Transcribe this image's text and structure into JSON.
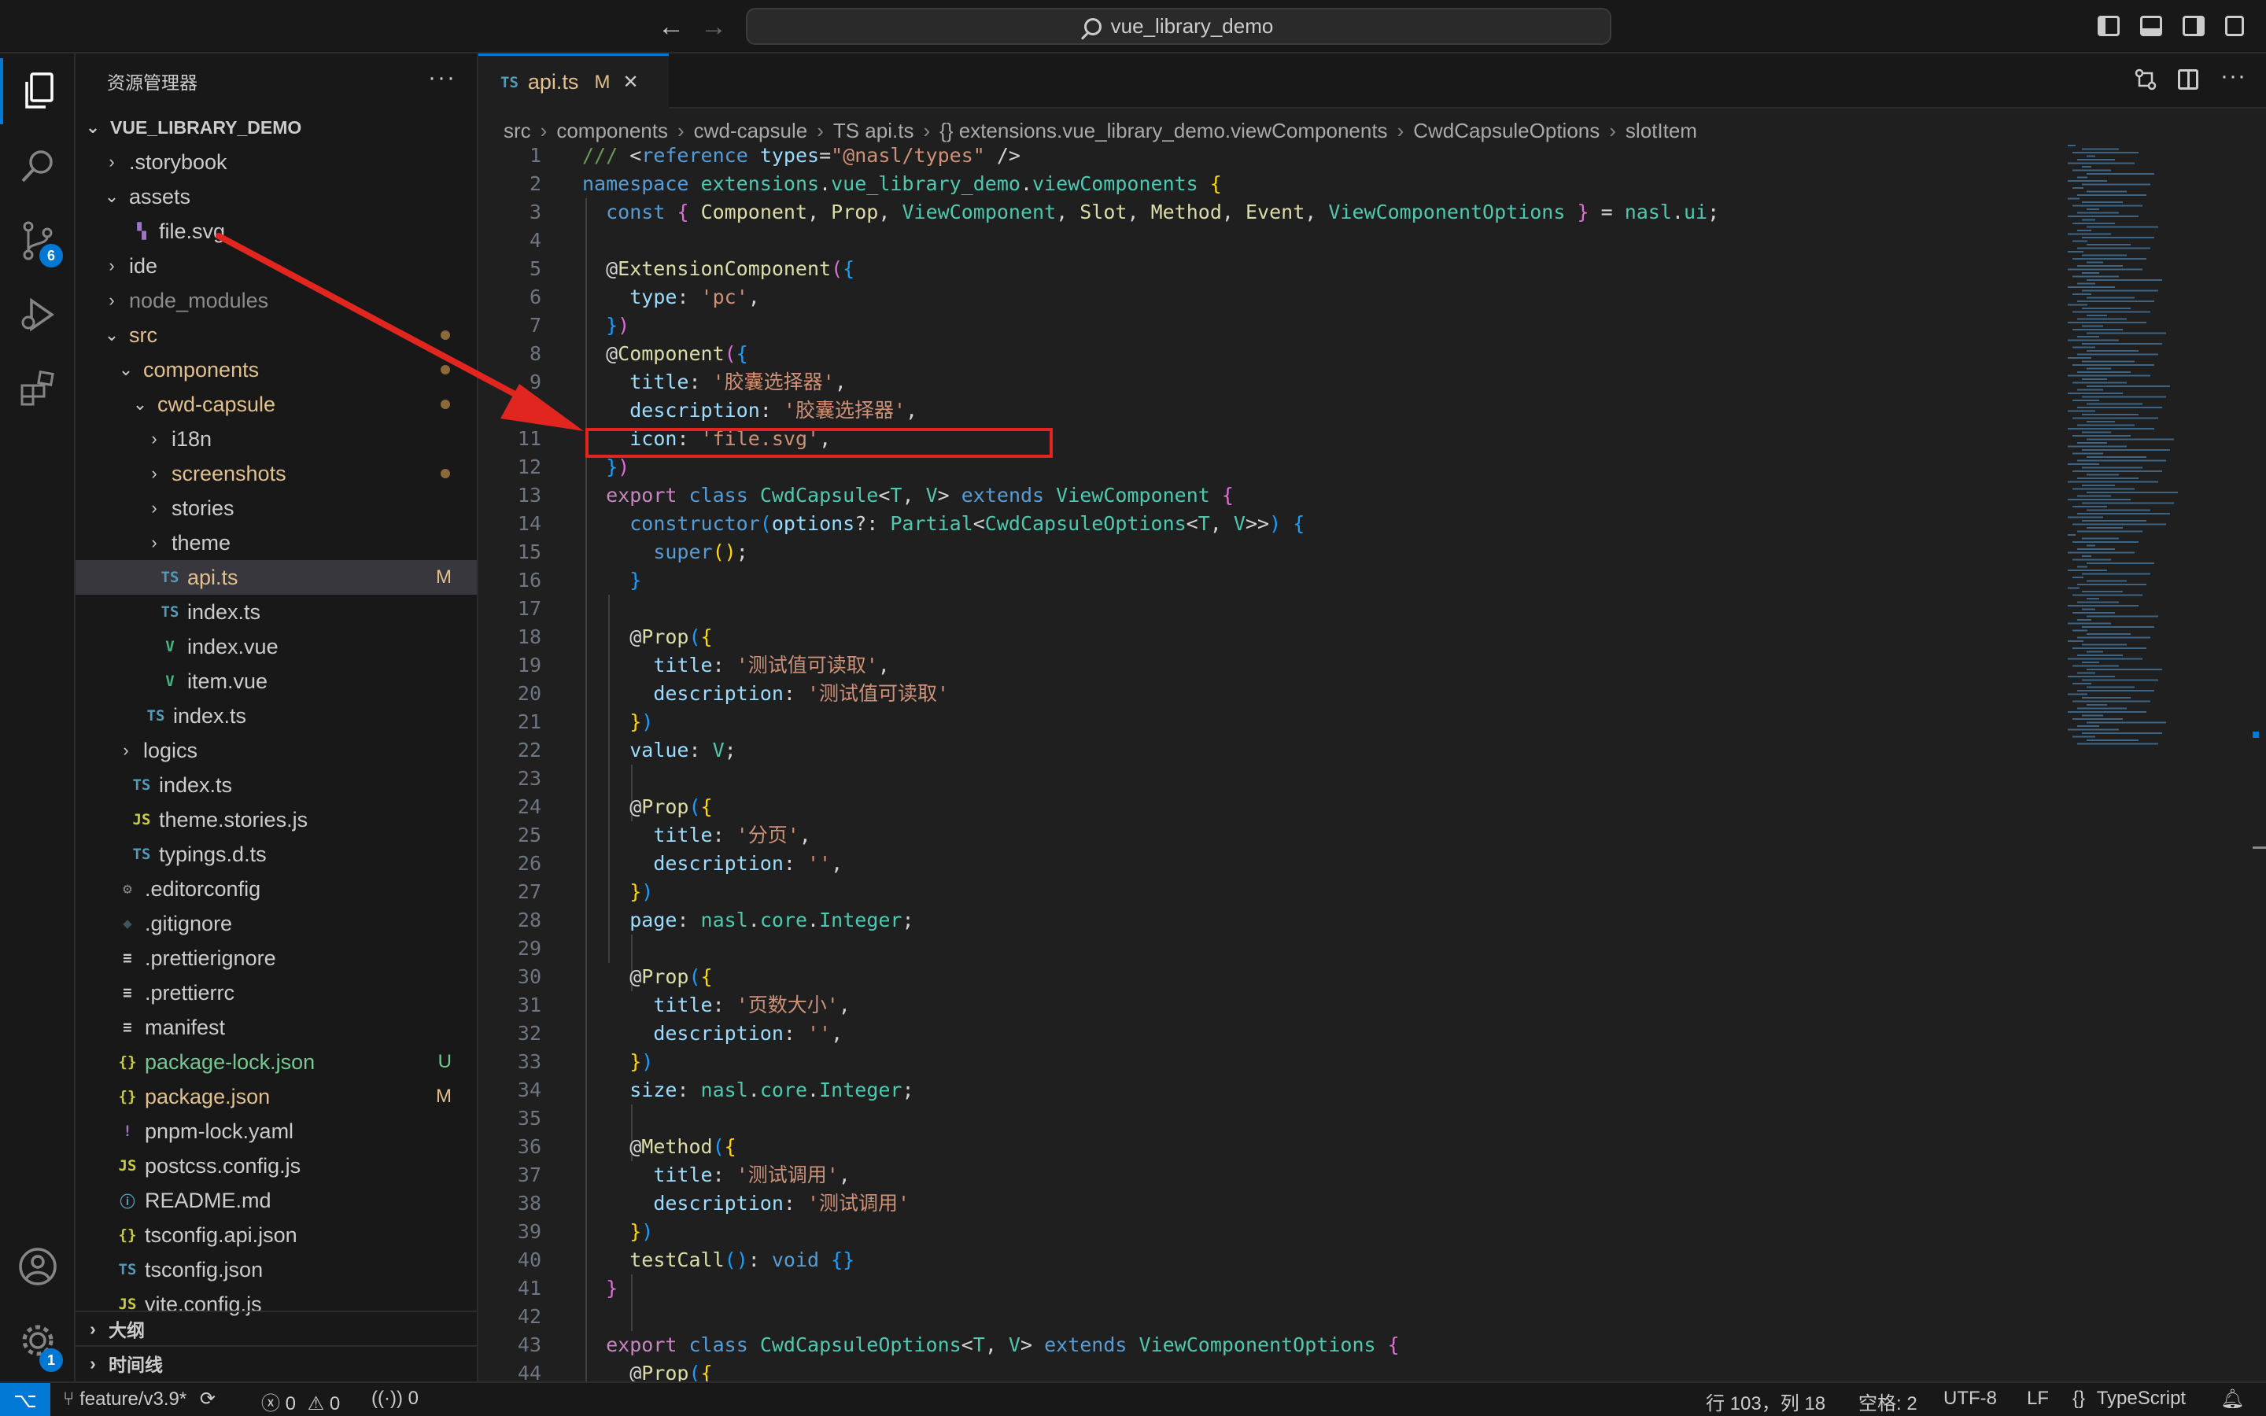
{
  "titlebar": {
    "search_text": "vue_library_demo",
    "back_icon": "arrow-left-icon",
    "forward_icon": "arrow-right-icon"
  },
  "activity_bar": {
    "source_control_badge": "6",
    "settings_badge": "1"
  },
  "sidebar": {
    "title": "资源管理器",
    "more": "···",
    "root_folder": "VUE_LIBRARY_DEMO",
    "items": [
      {
        "label": "storybook",
        "prefix": ".",
        "kind": "folder",
        "open": false,
        "depth": 1,
        "color": "#cccccc"
      },
      {
        "label": "assets",
        "prefix": "",
        "kind": "folder",
        "open": true,
        "depth": 1,
        "color": "#cccccc"
      },
      {
        "label": "file.svg",
        "prefix": "",
        "kind": "svg",
        "depth": 2,
        "color": "#cccccc"
      },
      {
        "label": "ide",
        "prefix": "",
        "kind": "folder",
        "open": false,
        "depth": 1,
        "color": "#cccccc"
      },
      {
        "label": "node_modules",
        "prefix": "",
        "kind": "folder",
        "open": false,
        "depth": 1,
        "color": "#8b8b8b"
      },
      {
        "label": "src",
        "prefix": "",
        "kind": "folder",
        "open": true,
        "depth": 1,
        "color": "#e2c08d",
        "dot": true
      },
      {
        "label": "components",
        "prefix": "",
        "kind": "folder",
        "open": true,
        "depth": 2,
        "color": "#e2c08d",
        "dot": true
      },
      {
        "label": "cwd-capsule",
        "prefix": "",
        "kind": "folder",
        "open": true,
        "depth": 3,
        "color": "#e2c08d",
        "dot": true
      },
      {
        "label": "i18n",
        "prefix": "",
        "kind": "folder",
        "open": false,
        "depth": 4,
        "color": "#cccccc"
      },
      {
        "label": "screenshots",
        "prefix": "",
        "kind": "folder",
        "open": false,
        "depth": 4,
        "color": "#e2c08d",
        "dot": true
      },
      {
        "label": "stories",
        "prefix": "",
        "kind": "folder",
        "open": false,
        "depth": 4,
        "color": "#cccccc"
      },
      {
        "label": "theme",
        "prefix": "",
        "kind": "folder",
        "open": false,
        "depth": 4,
        "color": "#cccccc"
      },
      {
        "label": "api.ts",
        "prefix": "",
        "kind": "ts",
        "depth": 4,
        "color": "#e2c08d",
        "status": "M",
        "selected": true
      },
      {
        "label": "index.ts",
        "prefix": "",
        "kind": "ts",
        "depth": 4,
        "color": "#cccccc"
      },
      {
        "label": "index.vue",
        "prefix": "",
        "kind": "vue",
        "depth": 4,
        "color": "#cccccc"
      },
      {
        "label": "item.vue",
        "prefix": "",
        "kind": "vue",
        "depth": 4,
        "color": "#cccccc"
      },
      {
        "label": "index.ts",
        "prefix": "",
        "kind": "ts",
        "depth": 3,
        "color": "#cccccc"
      },
      {
        "label": "logics",
        "prefix": "",
        "kind": "folder",
        "open": false,
        "depth": 2,
        "color": "#cccccc"
      },
      {
        "label": "index.ts",
        "prefix": "",
        "kind": "ts",
        "depth": 2,
        "color": "#cccccc"
      },
      {
        "label": "theme.stories.js",
        "prefix": "",
        "kind": "js",
        "depth": 2,
        "color": "#cccccc"
      },
      {
        "label": "typings.d.ts",
        "prefix": "",
        "kind": "ts",
        "depth": 2,
        "color": "#cccccc"
      },
      {
        "label": "editorconfig",
        "prefix": ".",
        "kind": "gear",
        "depth": 1,
        "color": "#cccccc"
      },
      {
        "label": "gitignore",
        "prefix": ".",
        "kind": "git",
        "depth": 1,
        "color": "#cccccc"
      },
      {
        "label": "prettierignore",
        "prefix": ".",
        "kind": "lines",
        "depth": 1,
        "color": "#cccccc"
      },
      {
        "label": "prettierrc",
        "prefix": ".",
        "kind": "lines",
        "depth": 1,
        "color": "#cccccc"
      },
      {
        "label": "manifest",
        "prefix": "",
        "kind": "lines",
        "depth": 1,
        "color": "#cccccc"
      },
      {
        "label": "package-lock.json",
        "prefix": "",
        "kind": "json",
        "depth": 1,
        "color": "#73c991",
        "status": "U"
      },
      {
        "label": "package.json",
        "prefix": "",
        "kind": "json",
        "depth": 1,
        "color": "#e2c08d",
        "status": "M"
      },
      {
        "label": "pnpm-lock.yaml",
        "prefix": "",
        "kind": "yaml",
        "depth": 1,
        "color": "#cccccc"
      },
      {
        "label": "postcss.config.js",
        "prefix": "",
        "kind": "js",
        "depth": 1,
        "color": "#cccccc"
      },
      {
        "label": "README.md",
        "prefix": "",
        "kind": "info",
        "depth": 1,
        "color": "#cccccc"
      },
      {
        "label": "tsconfig.api.json",
        "prefix": "",
        "kind": "json",
        "depth": 1,
        "color": "#cccccc"
      },
      {
        "label": "tsconfig.json",
        "prefix": "",
        "kind": "tsconfig",
        "depth": 1,
        "color": "#cccccc"
      },
      {
        "label": "vite.config.js",
        "prefix": "",
        "kind": "js",
        "depth": 1,
        "color": "#cccccc"
      }
    ],
    "outline_label": "大纲",
    "timeline_label": "时间线"
  },
  "editor": {
    "tab": {
      "icon": "TS",
      "label": "api.ts",
      "status": "M",
      "close": "✕"
    },
    "breadcrumb": [
      "src",
      "components",
      "cwd-capsule",
      "TS api.ts",
      "{} extensions.vue_library_demo.viewComponents",
      "CwdCapsuleOptions",
      "slotItem"
    ],
    "lines": [
      [
        [
          "cm",
          "/// "
        ],
        [
          "tx",
          "<"
        ],
        [
          "kw",
          "reference"
        ],
        [
          "tx",
          " "
        ],
        [
          "vr",
          "types"
        ],
        [
          "tx",
          "="
        ],
        [
          "st",
          "\"@nasl/types\""
        ],
        [
          "tx",
          " />"
        ]
      ],
      [
        [
          "kw",
          "namespace"
        ],
        [
          "tx",
          " "
        ],
        [
          "ty",
          "extensions"
        ],
        [
          "tx",
          "."
        ],
        [
          "ty",
          "vue_library_demo"
        ],
        [
          "tx",
          "."
        ],
        [
          "ty",
          "viewComponents"
        ],
        [
          "tx",
          " "
        ],
        [
          "br",
          "{"
        ]
      ],
      [
        [
          "tx",
          "  "
        ],
        [
          "kw",
          "const"
        ],
        [
          "tx",
          " "
        ],
        [
          "br2",
          "{"
        ],
        [
          "tx",
          " "
        ],
        [
          "fn",
          "Component"
        ],
        [
          "tx",
          ", "
        ],
        [
          "fn",
          "Prop"
        ],
        [
          "tx",
          ", "
        ],
        [
          "ty",
          "ViewComponent"
        ],
        [
          "tx",
          ", "
        ],
        [
          "fn",
          "Slot"
        ],
        [
          "tx",
          ", "
        ],
        [
          "fn",
          "Method"
        ],
        [
          "tx",
          ", "
        ],
        [
          "fn",
          "Event"
        ],
        [
          "tx",
          ", "
        ],
        [
          "ty",
          "ViewComponentOptions"
        ],
        [
          "tx",
          " "
        ],
        [
          "br2",
          "}"
        ],
        [
          "tx",
          " = "
        ],
        [
          "ty",
          "nasl"
        ],
        [
          "tx",
          "."
        ],
        [
          "ty",
          "ui"
        ],
        [
          "tx",
          ";"
        ]
      ],
      [],
      [
        [
          "tx",
          "  @"
        ],
        [
          "fn",
          "ExtensionComponent"
        ],
        [
          "br2",
          "("
        ],
        [
          "br3",
          "{"
        ]
      ],
      [
        [
          "tx",
          "    "
        ],
        [
          "vr",
          "type"
        ],
        [
          "tx",
          ": "
        ],
        [
          "st",
          "'pc'"
        ],
        [
          "tx",
          ","
        ]
      ],
      [
        [
          "tx",
          "  "
        ],
        [
          "br3",
          "}"
        ],
        [
          "br2",
          ")"
        ]
      ],
      [
        [
          "tx",
          "  @"
        ],
        [
          "fn",
          "Component"
        ],
        [
          "br2",
          "("
        ],
        [
          "br3",
          "{"
        ]
      ],
      [
        [
          "tx",
          "    "
        ],
        [
          "vr",
          "title"
        ],
        [
          "tx",
          ": "
        ],
        [
          "st",
          "'胶囊选择器'"
        ],
        [
          "tx",
          ","
        ]
      ],
      [
        [
          "tx",
          "    "
        ],
        [
          "vr",
          "description"
        ],
        [
          "tx",
          ": "
        ],
        [
          "st",
          "'胶囊选择器'"
        ],
        [
          "tx",
          ","
        ]
      ],
      [
        [
          "tx",
          "    "
        ],
        [
          "vr",
          "icon"
        ],
        [
          "tx",
          ": "
        ],
        [
          "st",
          "'file.svg'"
        ],
        [
          "tx",
          ","
        ]
      ],
      [
        [
          "tx",
          "  "
        ],
        [
          "br3",
          "}"
        ],
        [
          "br2",
          ")"
        ]
      ],
      [
        [
          "tx",
          "  "
        ],
        [
          "kc",
          "export"
        ],
        [
          "tx",
          " "
        ],
        [
          "kw",
          "class"
        ],
        [
          "tx",
          " "
        ],
        [
          "ty",
          "CwdCapsule"
        ],
        [
          "tx",
          "<"
        ],
        [
          "ty",
          "T"
        ],
        [
          "tx",
          ", "
        ],
        [
          "ty",
          "V"
        ],
        [
          "tx",
          "> "
        ],
        [
          "kw",
          "extends"
        ],
        [
          "tx",
          " "
        ],
        [
          "ty",
          "ViewComponent"
        ],
        [
          "tx",
          " "
        ],
        [
          "br2",
          "{"
        ]
      ],
      [
        [
          "tx",
          "    "
        ],
        [
          "kw",
          "constructor"
        ],
        [
          "br3",
          "("
        ],
        [
          "vr",
          "options"
        ],
        [
          "tx",
          "?: "
        ],
        [
          "ty",
          "Partial"
        ],
        [
          "tx",
          "<"
        ],
        [
          "ty",
          "CwdCapsuleOptions"
        ],
        [
          "tx",
          "<"
        ],
        [
          "ty",
          "T"
        ],
        [
          "tx",
          ", "
        ],
        [
          "ty",
          "V"
        ],
        [
          "tx",
          ">>"
        ],
        [
          "br3",
          ")"
        ],
        [
          "tx",
          " "
        ],
        [
          "br3",
          "{"
        ]
      ],
      [
        [
          "tx",
          "      "
        ],
        [
          "kw",
          "super"
        ],
        [
          "br",
          "()"
        ],
        [
          "tx",
          ";"
        ]
      ],
      [
        [
          "tx",
          "    "
        ],
        [
          "br3",
          "}"
        ]
      ],
      [],
      [
        [
          "tx",
          "    @"
        ],
        [
          "fn",
          "Prop"
        ],
        [
          "br3",
          "("
        ],
        [
          "br",
          "{"
        ]
      ],
      [
        [
          "tx",
          "      "
        ],
        [
          "vr",
          "title"
        ],
        [
          "tx",
          ": "
        ],
        [
          "st",
          "'测试值可读取'"
        ],
        [
          "tx",
          ","
        ]
      ],
      [
        [
          "tx",
          "      "
        ],
        [
          "vr",
          "description"
        ],
        [
          "tx",
          ": "
        ],
        [
          "st",
          "'测试值可读取'"
        ]
      ],
      [
        [
          "tx",
          "    "
        ],
        [
          "br",
          "}"
        ],
        [
          "br3",
          ")"
        ]
      ],
      [
        [
          "tx",
          "    "
        ],
        [
          "vr",
          "value"
        ],
        [
          "tx",
          ": "
        ],
        [
          "ty",
          "V"
        ],
        [
          "tx",
          ";"
        ]
      ],
      [],
      [
        [
          "tx",
          "    @"
        ],
        [
          "fn",
          "Prop"
        ],
        [
          "br3",
          "("
        ],
        [
          "br",
          "{"
        ]
      ],
      [
        [
          "tx",
          "      "
        ],
        [
          "vr",
          "title"
        ],
        [
          "tx",
          ": "
        ],
        [
          "st",
          "'分页'"
        ],
        [
          "tx",
          ","
        ]
      ],
      [
        [
          "tx",
          "      "
        ],
        [
          "vr",
          "description"
        ],
        [
          "tx",
          ": "
        ],
        [
          "st",
          "''"
        ],
        [
          "tx",
          ","
        ]
      ],
      [
        [
          "tx",
          "    "
        ],
        [
          "br",
          "}"
        ],
        [
          "br3",
          ")"
        ]
      ],
      [
        [
          "tx",
          "    "
        ],
        [
          "vr",
          "page"
        ],
        [
          "tx",
          ": "
        ],
        [
          "ty",
          "nasl"
        ],
        [
          "tx",
          "."
        ],
        [
          "ty",
          "core"
        ],
        [
          "tx",
          "."
        ],
        [
          "ty",
          "Integer"
        ],
        [
          "tx",
          ";"
        ]
      ],
      [],
      [
        [
          "tx",
          "    @"
        ],
        [
          "fn",
          "Prop"
        ],
        [
          "br3",
          "("
        ],
        [
          "br",
          "{"
        ]
      ],
      [
        [
          "tx",
          "      "
        ],
        [
          "vr",
          "title"
        ],
        [
          "tx",
          ": "
        ],
        [
          "st",
          "'页数大小'"
        ],
        [
          "tx",
          ","
        ]
      ],
      [
        [
          "tx",
          "      "
        ],
        [
          "vr",
          "description"
        ],
        [
          "tx",
          ": "
        ],
        [
          "st",
          "''"
        ],
        [
          "tx",
          ","
        ]
      ],
      [
        [
          "tx",
          "    "
        ],
        [
          "br",
          "}"
        ],
        [
          "br3",
          ")"
        ]
      ],
      [
        [
          "tx",
          "    "
        ],
        [
          "vr",
          "size"
        ],
        [
          "tx",
          ": "
        ],
        [
          "ty",
          "nasl"
        ],
        [
          "tx",
          "."
        ],
        [
          "ty",
          "core"
        ],
        [
          "tx",
          "."
        ],
        [
          "ty",
          "Integer"
        ],
        [
          "tx",
          ";"
        ]
      ],
      [],
      [
        [
          "tx",
          "    @"
        ],
        [
          "fn",
          "Method"
        ],
        [
          "br3",
          "("
        ],
        [
          "br",
          "{"
        ]
      ],
      [
        [
          "tx",
          "      "
        ],
        [
          "vr",
          "title"
        ],
        [
          "tx",
          ": "
        ],
        [
          "st",
          "'测试调用'"
        ],
        [
          "tx",
          ","
        ]
      ],
      [
        [
          "tx",
          "      "
        ],
        [
          "vr",
          "description"
        ],
        [
          "tx",
          ": "
        ],
        [
          "st",
          "'测试调用'"
        ]
      ],
      [
        [
          "tx",
          "    "
        ],
        [
          "br",
          "}"
        ],
        [
          "br3",
          ")"
        ]
      ],
      [
        [
          "tx",
          "    "
        ],
        [
          "fn",
          "testCall"
        ],
        [
          "br3",
          "()"
        ],
        [
          "tx",
          ": "
        ],
        [
          "kw",
          "void"
        ],
        [
          "tx",
          " "
        ],
        [
          "br3",
          "{}"
        ]
      ],
      [
        [
          "tx",
          "  "
        ],
        [
          "br2",
          "}"
        ]
      ],
      [],
      [
        [
          "tx",
          "  "
        ],
        [
          "kc",
          "export"
        ],
        [
          "tx",
          " "
        ],
        [
          "kw",
          "class"
        ],
        [
          "tx",
          " "
        ],
        [
          "ty",
          "CwdCapsuleOptions"
        ],
        [
          "tx",
          "<"
        ],
        [
          "ty",
          "T"
        ],
        [
          "tx",
          ", "
        ],
        [
          "ty",
          "V"
        ],
        [
          "tx",
          "> "
        ],
        [
          "kw",
          "extends"
        ],
        [
          "tx",
          " "
        ],
        [
          "ty",
          "ViewComponentOptions"
        ],
        [
          "tx",
          " "
        ],
        [
          "br2",
          "{"
        ]
      ],
      [
        [
          "tx",
          "    @"
        ],
        [
          "fn",
          "Prop"
        ],
        [
          "br3",
          "("
        ],
        [
          "br",
          "{"
        ]
      ]
    ]
  },
  "statusbar": {
    "branch": "feature/v3.9*",
    "errors": "0",
    "warnings": "0",
    "ports": "0",
    "position": "行 103，列 18",
    "spaces": "空格: 2",
    "encoding": "UTF-8",
    "eol": "LF",
    "language": "TypeScript",
    "language_icon": "{}"
  },
  "colors": {
    "accent": "#0078d4",
    "annotation": "#e0261f"
  }
}
